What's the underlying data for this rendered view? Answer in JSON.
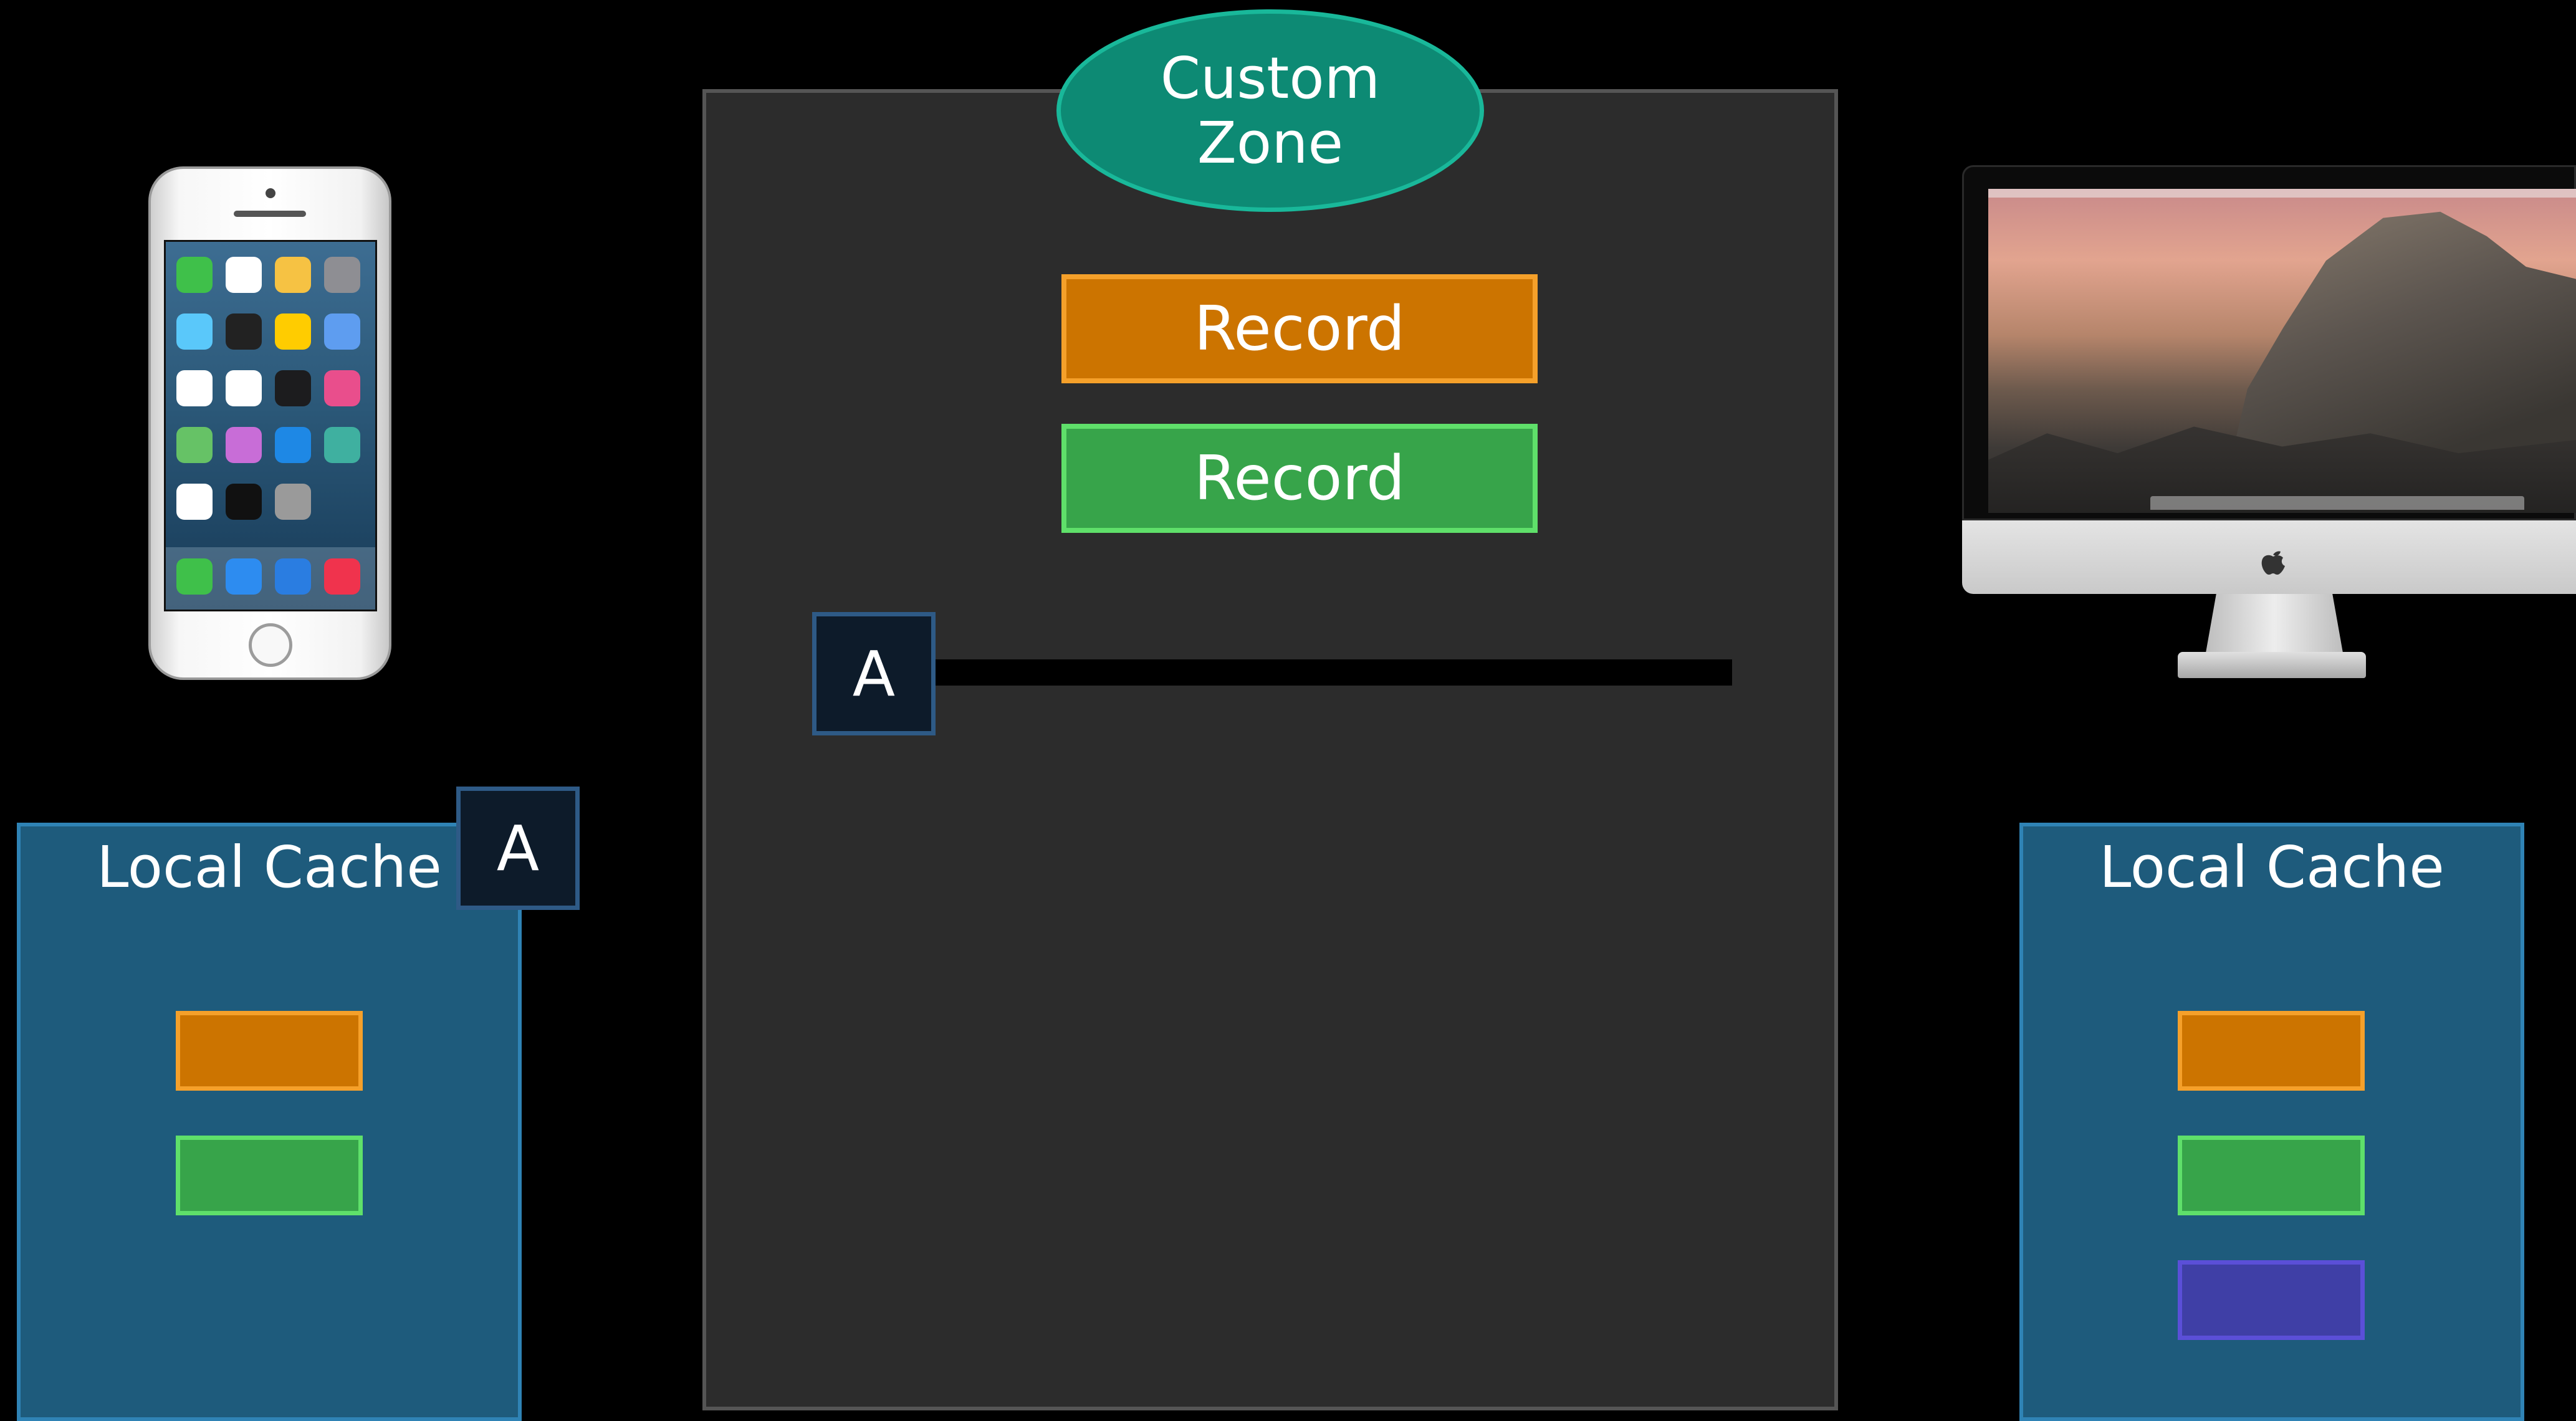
{
  "zone": {
    "line1": "Custom",
    "line2": "Zone"
  },
  "server": {
    "records": [
      {
        "label": "Record",
        "fill": "#cc7400",
        "border": "#f5a02a"
      },
      {
        "label": "Record",
        "fill": "#37a44a",
        "border": "#5fe06a"
      }
    ],
    "token_label": "A"
  },
  "left_device": {
    "icon": "iphone-icon"
  },
  "right_device": {
    "icon": "imac-icon"
  },
  "left_cache": {
    "title": "Local Cache",
    "token_label": "A",
    "items": [
      {
        "fill": "#cc7400",
        "border": "#f5a02a"
      },
      {
        "fill": "#37a44a",
        "border": "#5fe06a"
      }
    ]
  },
  "right_cache": {
    "title": "Local Cache",
    "items": [
      {
        "fill": "#cc7400",
        "border": "#f5a02a"
      },
      {
        "fill": "#37a44a",
        "border": "#5fe06a"
      },
      {
        "fill": "#3f3fa6",
        "border": "#5b4fd8"
      }
    ]
  },
  "colors": {
    "background": "#000000",
    "server_panel": "#2c2c2c",
    "zone": "#0d8a74",
    "cache": "#1e5b7c",
    "token": "#0d1b2a"
  }
}
